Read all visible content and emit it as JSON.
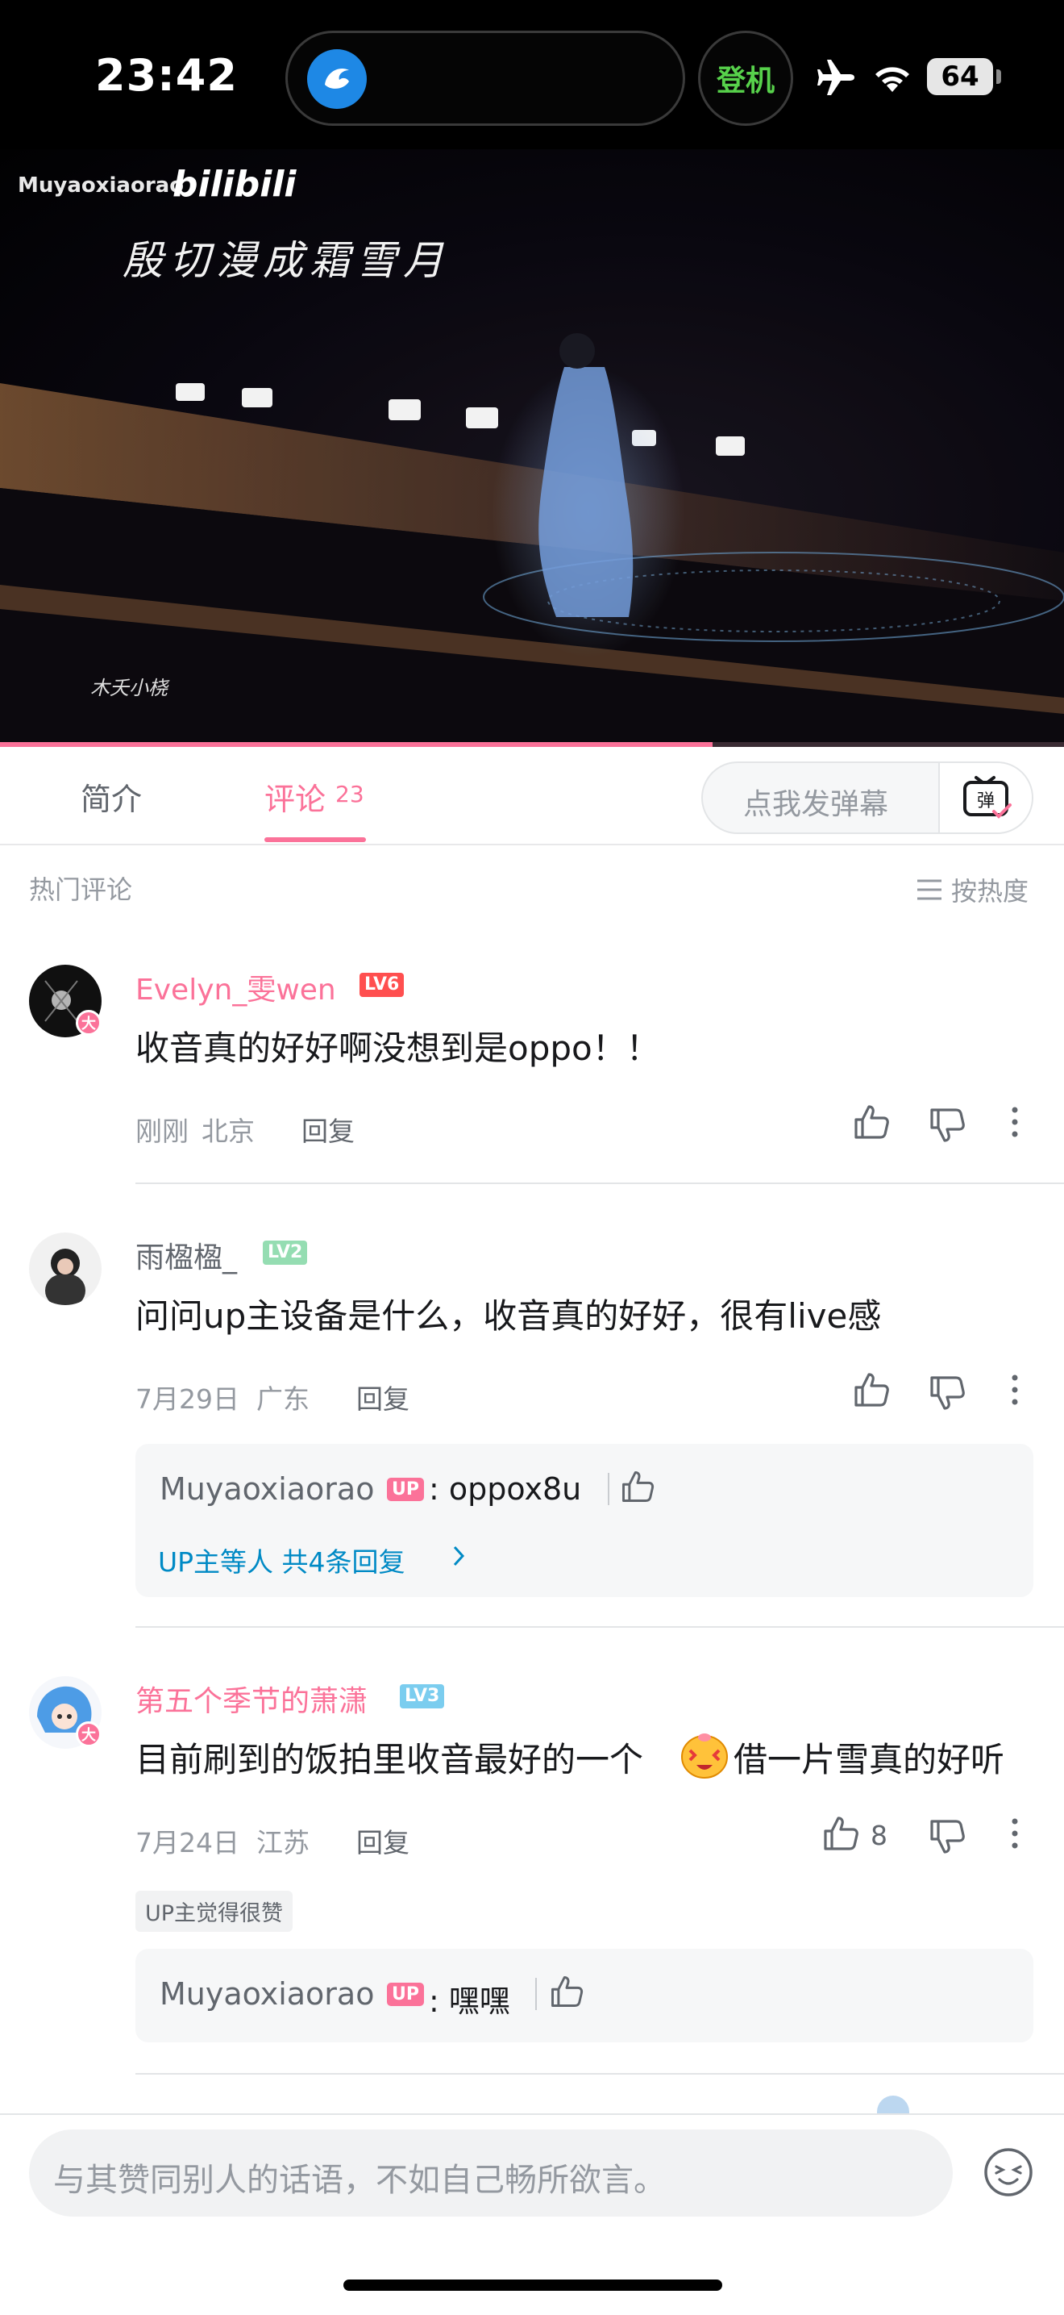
{
  "status_bar": {
    "time": "23:42",
    "island_pill_text": "登机",
    "battery": "64",
    "icons": [
      "app-icon",
      "airplane-icon",
      "wifi-icon",
      "battery-icon"
    ]
  },
  "video": {
    "brand": "Muyaoxiaorao",
    "platform": "bilibili",
    "caption": "殷切漫成霜雪月",
    "signature": "木夭小桡",
    "progress": 0.67
  },
  "tabs": {
    "intro": "简介",
    "comments": "评论",
    "comments_count": "23",
    "danmaku_placeholder": "点我发弹幕",
    "danmaku_button": "弹"
  },
  "comments_header": {
    "title": "热门评论",
    "sort": "按热度"
  },
  "comments": [
    {
      "username": "Evelyn_雯wen",
      "level": "LV6",
      "text": "收音真的好好啊没想到是oppo！！",
      "time": "刚刚",
      "location": "北京",
      "reply_label": "回复",
      "likes": ""
    },
    {
      "username": "雨楹楹_",
      "level": "LV2",
      "text": "问问up主设备是什么，收音真的好好，很有live感",
      "time": "7月29日",
      "location": "广东",
      "reply_label": "回复",
      "likes": "",
      "reply_preview": {
        "name": "Muyaoxiaorao",
        "badge": "UP",
        "text": ": oppox8u",
        "more": "UP主等人 共4条回复"
      }
    },
    {
      "username": "第五个季节的萧潇",
      "level": "LV3",
      "text_a": "目前刷到的饭拍里收音最好的一个",
      "text_b": "借一片雪真的好听",
      "time": "7月24日",
      "location": "江苏",
      "reply_label": "回复",
      "likes": "8",
      "up_tag": "UP主觉得很赞",
      "reply_preview": {
        "name": "Muyaoxiaorao",
        "badge": "UP",
        "text": ": 嘿嘿"
      }
    }
  ],
  "badges": {
    "big_member": "大"
  },
  "bottom": {
    "placeholder": "与其赞同别人的话语，不如自己畅所欲言。"
  },
  "colors": {
    "accent": "#fb7299",
    "lv6": "#ff4f4f",
    "lv2": "#95ddb2",
    "lv3": "#7bcdef",
    "link": "#008ac5"
  }
}
